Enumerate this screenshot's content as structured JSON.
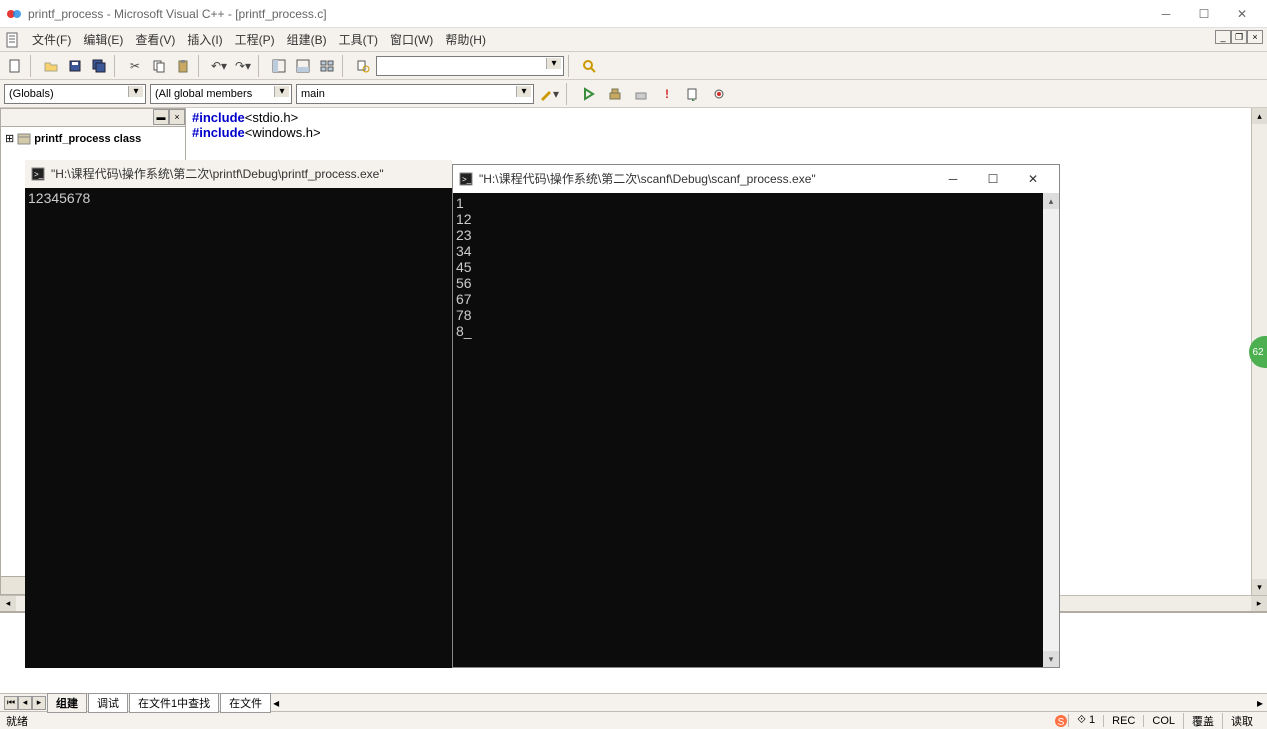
{
  "window": {
    "title": "printf_process - Microsoft Visual C++ - [printf_process.c]"
  },
  "menu": {
    "file": "文件(F)",
    "edit": "编辑(E)",
    "view": "查看(V)",
    "insert": "插入(I)",
    "project": "工程(P)",
    "build": "组建(B)",
    "tools": "工具(T)",
    "window": "窗口(W)",
    "help": "帮助(H)"
  },
  "combos": {
    "scope": "(Globals)",
    "members": "(All global members",
    "func": "main",
    "longcombo": ""
  },
  "tree": {
    "root": "printf_process class"
  },
  "code": {
    "line1_pp": "#include",
    "line1_rest": "<stdio.h>",
    "line2_pp": "#include",
    "line2_rest": "<windows.h>"
  },
  "output": {
    "tabs": {
      "build": "组建",
      "debug": "调试",
      "find1": "在文件1中查找",
      "find2": "在文件"
    }
  },
  "status": {
    "ready": "就绪",
    "rec": "REC",
    "col": "COL",
    "ovr": "覆盖",
    "read": "读取"
  },
  "console1": {
    "title": "\"H:\\课程代码\\操作系统\\第二次\\printf\\Debug\\printf_process.exe\"",
    "body": "12345678"
  },
  "console2": {
    "title": "\"H:\\课程代码\\操作系统\\第二次\\scanf\\Debug\\scanf_process.exe\"",
    "body": "1\n12\n23\n34\n45\n56\n67\n78\n8_"
  },
  "badge": "62"
}
